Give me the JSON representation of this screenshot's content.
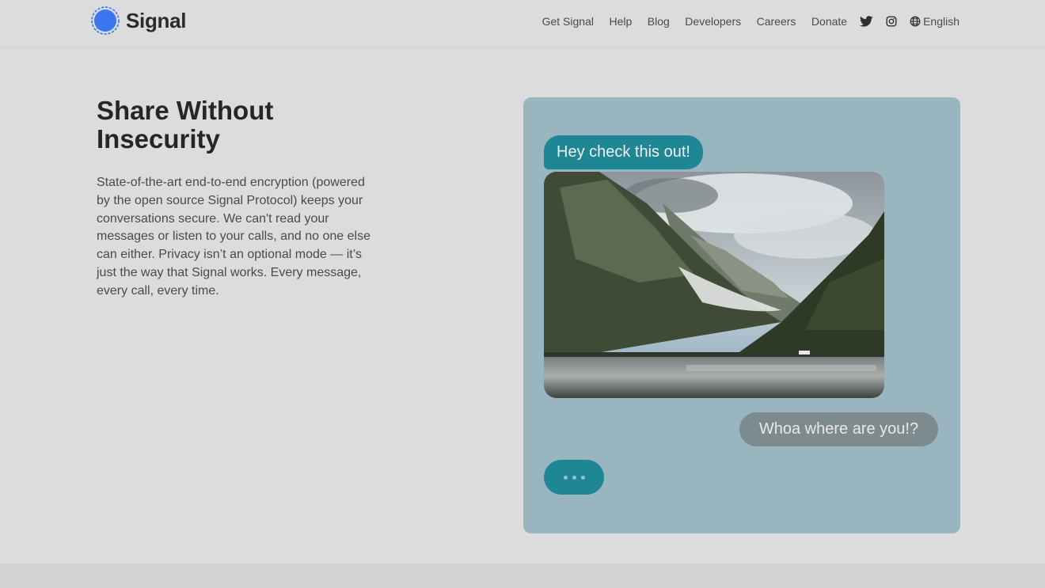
{
  "header": {
    "brand": "Signal",
    "nav": [
      "Get Signal",
      "Help",
      "Blog",
      "Developers",
      "Careers",
      "Donate"
    ],
    "social_icons": [
      "twitter-icon",
      "instagram-icon"
    ],
    "language": "English"
  },
  "hero": {
    "title": "Share Without Insecurity",
    "body": "State-of-the-art end-to-end encryption (powered by the open source Signal Protocol) keeps your conversations secure. We can't read your messages or listen to your calls, and no one else can either. Privacy isn’t an optional mode — it’s just the way that Signal works. Every message, every call, every time."
  },
  "chat": {
    "incoming_message": "Hey check this out!",
    "photo_icon": "mountain-lake-photo",
    "outgoing_message": "Whoa where are you!?",
    "typing_indicator": "typing-dots-icon"
  },
  "colors": {
    "accent": "#1f8693",
    "card_background": "#99b5bf",
    "outgoing_bubble": "#7d8b8e",
    "brand_blue": "#3a76f0"
  }
}
